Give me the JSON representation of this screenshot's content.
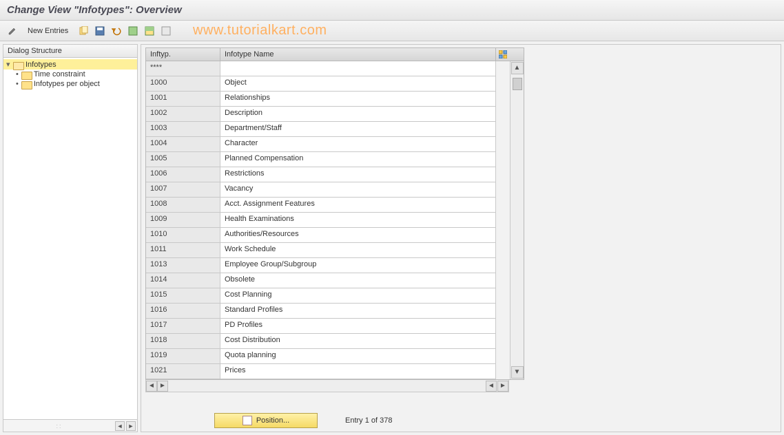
{
  "title": "Change View \"Infotypes\": Overview",
  "toolbar": {
    "new_entries_label": "New Entries"
  },
  "watermark": "www.tutorialkart.com",
  "dialog_structure": {
    "header": "Dialog Structure",
    "root": "Infotypes",
    "children": [
      "Time constraint",
      "Infotypes per object"
    ]
  },
  "grid": {
    "col_code": "Inftyp.",
    "col_name": "Infotype Name",
    "rows": [
      {
        "code": "****",
        "name": ""
      },
      {
        "code": "1000",
        "name": "Object"
      },
      {
        "code": "1001",
        "name": "Relationships"
      },
      {
        "code": "1002",
        "name": "Description"
      },
      {
        "code": "1003",
        "name": "Department/Staff"
      },
      {
        "code": "1004",
        "name": "Character"
      },
      {
        "code": "1005",
        "name": "Planned Compensation"
      },
      {
        "code": "1006",
        "name": "Restrictions"
      },
      {
        "code": "1007",
        "name": "Vacancy"
      },
      {
        "code": "1008",
        "name": "Acct. Assignment Features"
      },
      {
        "code": "1009",
        "name": "Health Examinations"
      },
      {
        "code": "1010",
        "name": "Authorities/Resources"
      },
      {
        "code": "1011",
        "name": "Work Schedule"
      },
      {
        "code": "1013",
        "name": "Employee Group/Subgroup"
      },
      {
        "code": "1014",
        "name": "Obsolete"
      },
      {
        "code": "1015",
        "name": "Cost Planning"
      },
      {
        "code": "1016",
        "name": "Standard Profiles"
      },
      {
        "code": "1017",
        "name": "PD Profiles"
      },
      {
        "code": "1018",
        "name": "Cost Distribution"
      },
      {
        "code": "1019",
        "name": "Quota planning"
      },
      {
        "code": "1021",
        "name": "Prices"
      }
    ]
  },
  "position_label": "Position...",
  "entry_label": "Entry 1 of 378"
}
